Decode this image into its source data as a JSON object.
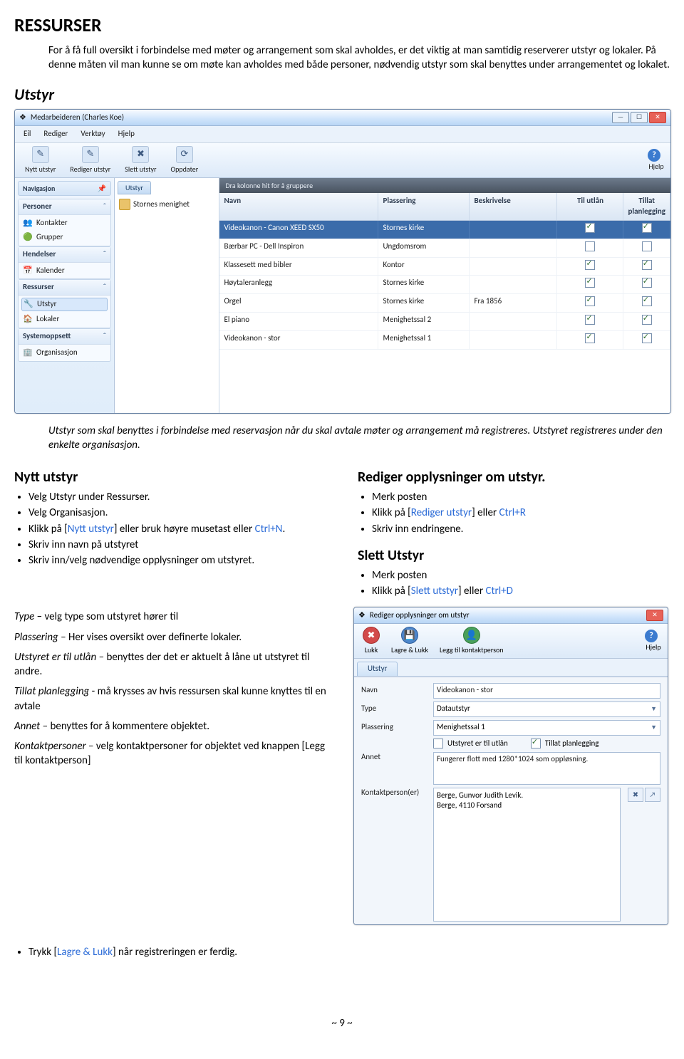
{
  "doc": {
    "title": "RESSURSER",
    "intro": "For å få full oversikt i forbindelse med møter og arrangement som skal avholdes, er det viktig at man samtidig reserverer utstyr og lokaler. På denne måten vil man kunne se om møte kan avholdes med både personer, nødvendig utstyr som skal benyttes under arrangementet og lokalet.",
    "utstyr_heading": "Utstyr",
    "utstyr_note": "Utstyr som skal benyttes i forbindelse med reservasjon når du skal avtale møter og arrangement må registreres. Utstyret registreres under den enkelte organisasjon.",
    "nytt_heading": "Nytt utstyr",
    "nytt_items": [
      "Velg Utstyr under Ressurser.",
      "Velg Organisasjon.",
      {
        "pre": "Klikk på [",
        "link": "Nytt utstyr",
        "post": "] eller bruk høyre musetast eller ",
        "link2": "Ctrl+N",
        "post2": "."
      },
      "Skriv inn navn på utstyret",
      "Skriv inn/velg nødvendige opplysninger om utstyret."
    ],
    "rediger_heading": "Rediger opplysninger om utstyr.",
    "rediger_items": [
      "Merk posten",
      {
        "pre": "Klikk på [",
        "link": "Rediger utstyr",
        "post": "] eller ",
        "link2": "Ctrl+R",
        "post2": ""
      },
      "Skriv inn endringene."
    ],
    "slett_heading": "Slett Utstyr",
    "slett_items": [
      "Merk posten",
      {
        "pre": "Klikk på [",
        "link": "Slett utstyr",
        "post": "] eller ",
        "link2": "Ctrl+D",
        "post2": ""
      }
    ],
    "defs": [
      {
        "term": "Type",
        "rest": " – velg type som utstyret hører til"
      },
      {
        "term": "Plassering",
        "rest": " – Her vises oversikt over definerte lokaler."
      },
      {
        "term": "Utstyret er til utlån",
        "rest": " – benyttes der det er aktuelt å låne ut utstyret til andre."
      },
      {
        "term": "Tillat planlegging",
        "rest": " - må krysses av hvis ressursen skal kunne knyttes til en avtale"
      },
      {
        "term": "Annet",
        "rest": " – benyttes for å kommentere objektet."
      },
      {
        "term": "Kontaktpersoner",
        "rest": " – velg kontaktpersoner for objektet ved knappen [Legg til kontaktperson]"
      }
    ],
    "final": {
      "pre": "Trykk [",
      "link": "Lagre & Lukk",
      "post": "] når registreringen er ferdig."
    },
    "page_no": "~ 9 ~"
  },
  "app": {
    "title": "Medarbeideren (Charles Koe)",
    "menus": [
      "Eil",
      "Rediger",
      "Verktøy",
      "Hjelp"
    ],
    "toolbar": [
      "Nytt utstyr",
      "Rediger utstyr",
      "Slett utstyr",
      "Oppdater"
    ],
    "help": "Hjelp",
    "nav_title": "Navigasjon",
    "groups": [
      {
        "title": "Personer",
        "items": [
          "Kontakter",
          "Grupper"
        ]
      },
      {
        "title": "Hendelser",
        "items": [
          "Kalender"
        ]
      },
      {
        "title": "Ressurser",
        "items": [
          "Utstyr",
          "Lokaler"
        ],
        "active": "Utstyr"
      },
      {
        "title": "Systemoppsett",
        "items": [
          "Organisasjon"
        ]
      }
    ],
    "tab": "Utstyr",
    "tree_item": "Stornes menighet",
    "group_bar": "Dra kolonne hit for å gruppere",
    "columns": [
      "Navn",
      "Plassering",
      "Beskrivelse",
      "Til utlån",
      "Tillat planlegging"
    ],
    "rows": [
      {
        "navn": "Videokanon - Canon XEED SX50",
        "plass": "Stornes kirke",
        "besk": "",
        "utlan": true,
        "tillat": true,
        "sel": true
      },
      {
        "navn": "Bærbar PC - Dell Inspiron",
        "plass": "Ungdomsrom",
        "besk": "",
        "utlan": false,
        "tillat": false
      },
      {
        "navn": "Klassesett med bibler",
        "plass": "Kontor",
        "besk": "",
        "utlan": true,
        "tillat": true
      },
      {
        "navn": "Høytaleranlegg",
        "plass": "Stornes kirke",
        "besk": "",
        "utlan": true,
        "tillat": true
      },
      {
        "navn": "Orgel",
        "plass": "Stornes kirke",
        "besk": "Fra 1856",
        "utlan": true,
        "tillat": true
      },
      {
        "navn": "El piano",
        "plass": "Menighetssal 2",
        "besk": "",
        "utlan": true,
        "tillat": true
      },
      {
        "navn": "Videokanon - stor",
        "plass": "Menighetssal 1",
        "besk": "",
        "utlan": true,
        "tillat": true
      }
    ]
  },
  "dialog": {
    "title": "Rediger opplysninger om utstyr",
    "toolbar": [
      "Lukk",
      "Lagre & Lukk",
      "Legg til kontaktperson"
    ],
    "help": "Hjelp",
    "tab": "Utstyr",
    "fields": {
      "navn_label": "Navn",
      "navn": "Videokanon - stor",
      "type_label": "Type",
      "type": "Datautstyr",
      "plass_label": "Plassering",
      "plass": "Menighetssal 1",
      "chk1": "Utstyret er til utlån",
      "chk2": "Tillat planlegging",
      "annet_label": "Annet",
      "annet": "Fungerer flott med 1280*1024 som oppløsning.",
      "kp_label": "Kontaktperson(er)",
      "kp_lines": [
        "Berge, Gunvor Judith Levik.",
        "Berge, 4110 Forsand"
      ]
    }
  }
}
